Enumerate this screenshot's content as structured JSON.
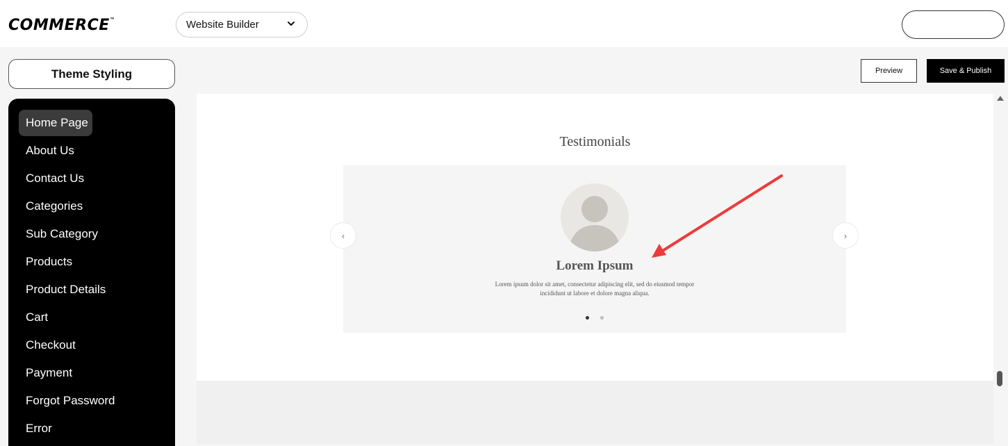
{
  "header": {
    "logo_text": "COMMERCE",
    "logo_mark": "™",
    "site_selector": "Website Builder"
  },
  "sidebar": {
    "theme_styling": "Theme Styling",
    "items": [
      {
        "label": "Home Page",
        "active": true
      },
      {
        "label": "About Us"
      },
      {
        "label": "Contact Us"
      },
      {
        "label": "Categories"
      },
      {
        "label": "Sub Category"
      },
      {
        "label": "Products"
      },
      {
        "label": "Product Details"
      },
      {
        "label": "Cart"
      },
      {
        "label": "Checkout"
      },
      {
        "label": "Payment"
      },
      {
        "label": "Forgot Password"
      },
      {
        "label": "Error"
      }
    ]
  },
  "toolbar": {
    "preview": "Preview",
    "save_publish": "Save & Publish"
  },
  "canvas": {
    "section_title": "Testimonials",
    "testimonial": {
      "name": "Lorem Ipsum",
      "text": "Lorem ipsum dolor sit amet, consectetur adipiscing elit, sed do eiusmod tempor incididunt ut labore et dolore magna aliqua."
    },
    "prev_arrow": "‹",
    "next_arrow": "›",
    "slide_count": 2,
    "active_slide": 1
  },
  "colors": {
    "annotation_arrow": "#ee3a3a",
    "sidebar_bg": "#000000",
    "sidebar_active": "#3b3b3b"
  }
}
